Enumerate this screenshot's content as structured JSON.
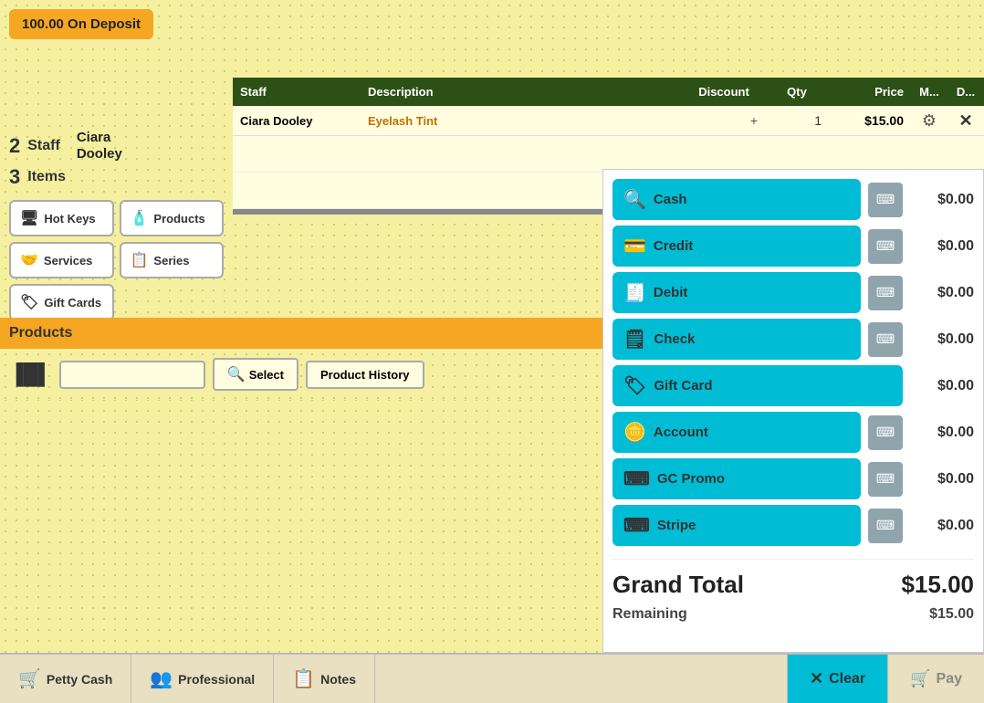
{
  "deposit": {
    "label": "100.00 On Deposit"
  },
  "staff": {
    "number": "2",
    "label": "Staff",
    "name_line1": "Ciara",
    "name_line2": "Dooley"
  },
  "table": {
    "headers": {
      "staff": "Staff",
      "description": "Description",
      "discount": "Discount",
      "qty": "Qty",
      "price": "Price",
      "m": "M...",
      "d": "D..."
    },
    "rows": [
      {
        "staff": "Ciara Dooley",
        "description": "Eyelash Tint",
        "discount": "+",
        "qty": "1",
        "price": "$15.00"
      }
    ]
  },
  "items": {
    "number": "3",
    "label": "Items",
    "buttons": [
      {
        "id": "hot-keys",
        "icon": "🖥",
        "label": "Hot Keys"
      },
      {
        "id": "services",
        "icon": "🤝",
        "label": "Services"
      },
      {
        "id": "products",
        "icon": "🧴",
        "label": "Products"
      },
      {
        "id": "series",
        "icon": "📋",
        "label": "Series"
      },
      {
        "id": "gift-cards",
        "icon": "🏷",
        "label": "Gift Cards"
      }
    ]
  },
  "products_section": {
    "header": "Products",
    "select_btn": "Select",
    "history_btn": "Product History",
    "input_placeholder": ""
  },
  "payment": {
    "methods": [
      {
        "id": "cash",
        "label": "Cash",
        "amount": "$0.00",
        "has_calc": true
      },
      {
        "id": "credit",
        "label": "Credit",
        "amount": "$0.00",
        "has_calc": true
      },
      {
        "id": "debit",
        "label": "Debit",
        "amount": "$0.00",
        "has_calc": true
      },
      {
        "id": "check",
        "label": "Check",
        "amount": "$0.00",
        "has_calc": true
      },
      {
        "id": "gift-card",
        "label": "Gift Card",
        "amount": "$0.00",
        "has_calc": false
      },
      {
        "id": "account",
        "label": "Account",
        "amount": "$0.00",
        "has_calc": true
      },
      {
        "id": "gc-promo",
        "label": "GC Promo",
        "amount": "$0.00",
        "has_calc": true
      },
      {
        "id": "stripe",
        "label": "Stripe",
        "amount": "$0.00",
        "has_calc": true
      }
    ],
    "grand_total_label": "Grand Total",
    "grand_total_value": "$15.00",
    "remaining_label": "Remaining",
    "remaining_value": "$15.00"
  },
  "bottom_bar": {
    "petty_cash": "Petty Cash",
    "professional": "Professional",
    "notes": "Notes",
    "clear": "Clear",
    "pay": "Pay"
  }
}
